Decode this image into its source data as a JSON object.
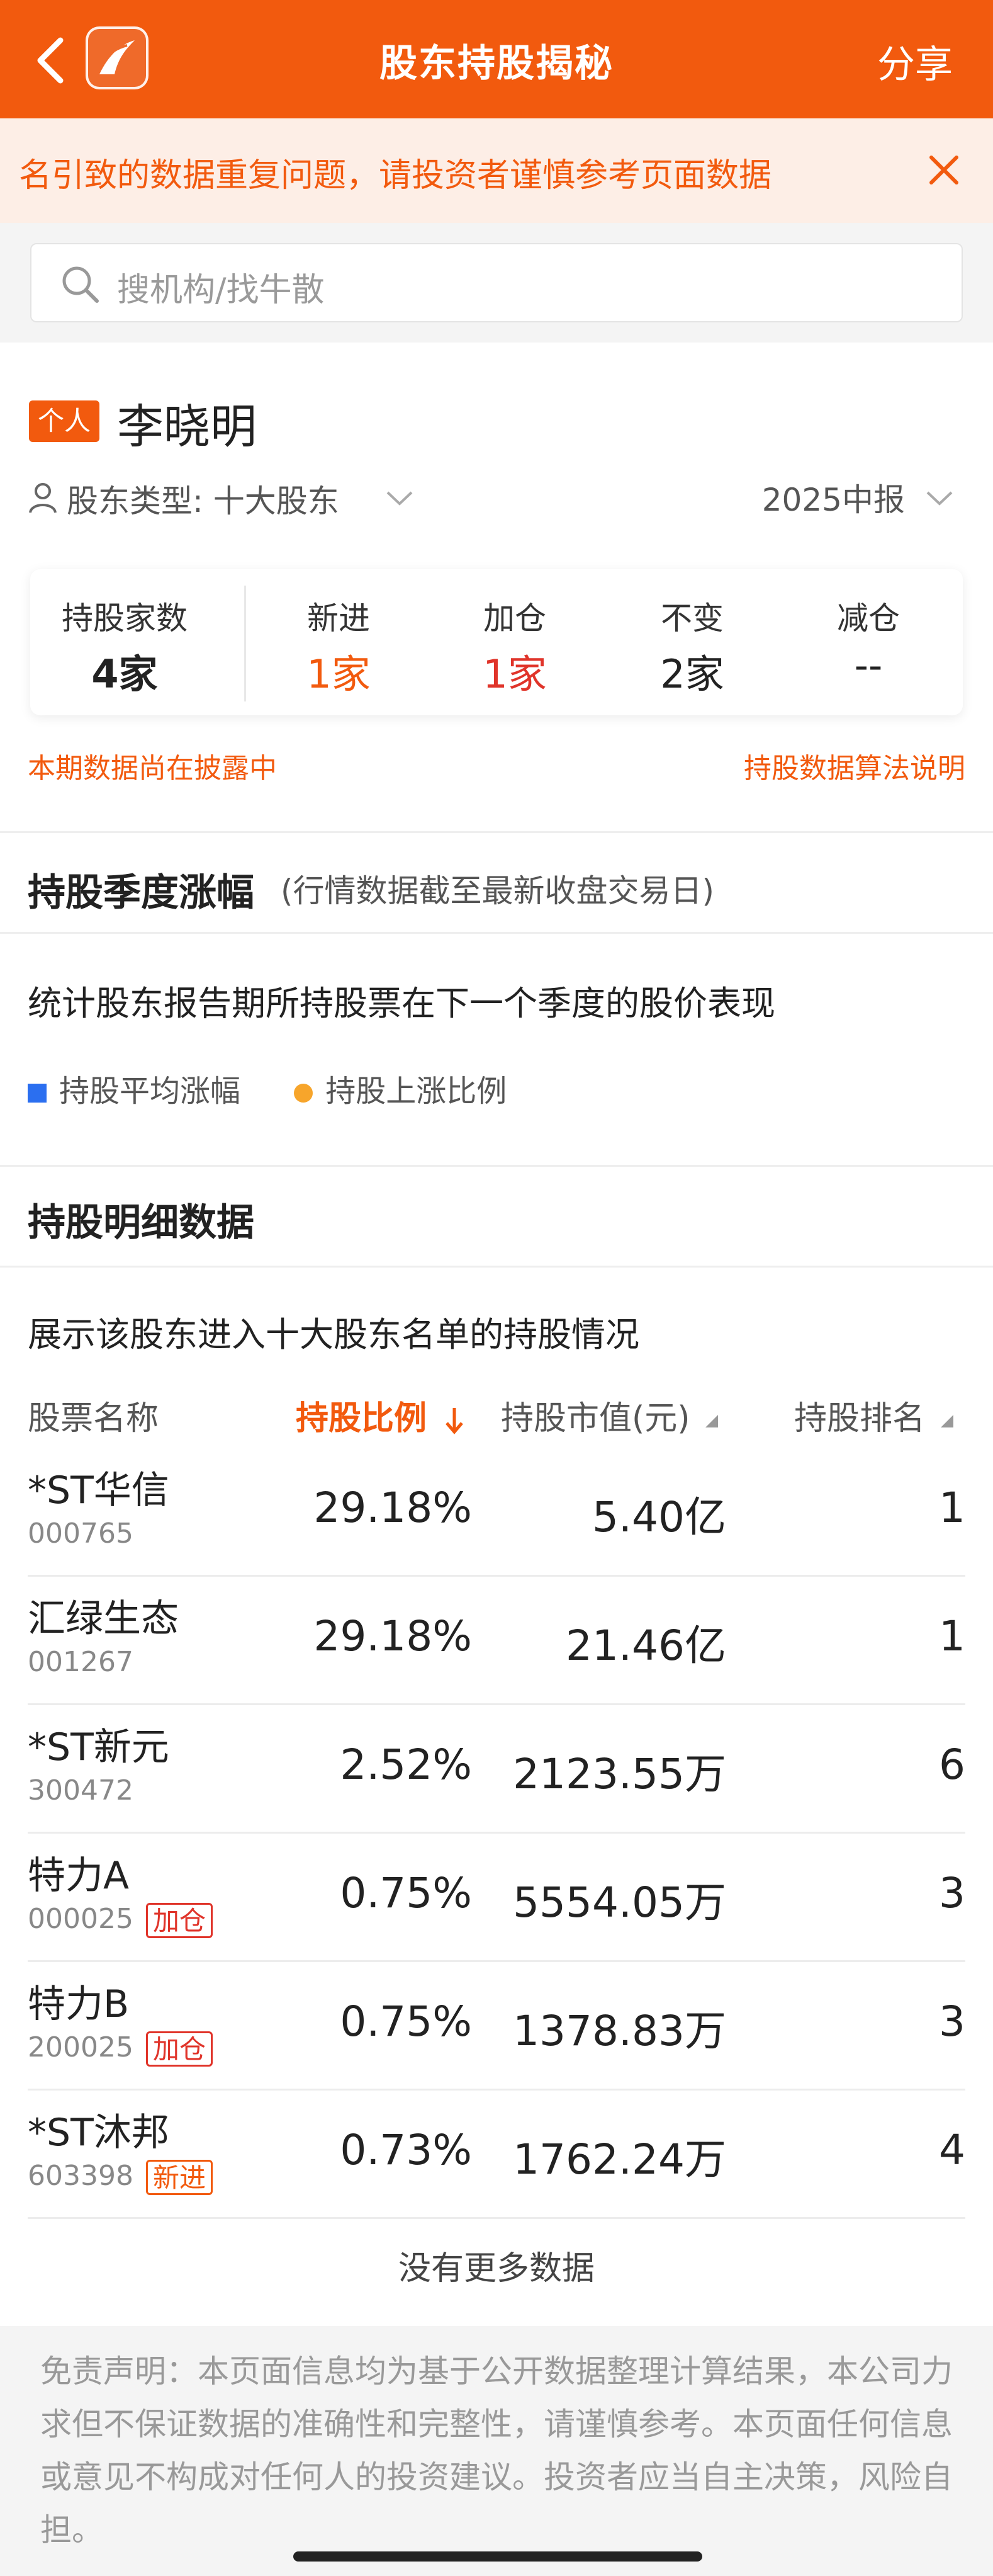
{
  "header": {
    "title": "股东持股揭秘",
    "share_label": "分享",
    "brand_color": "#f25a0e"
  },
  "notice": {
    "text": "名引致的数据重复问题，请投资者谨慎参考页面数据"
  },
  "search": {
    "placeholder": "搜机构/找牛散"
  },
  "profile": {
    "badge": "个人",
    "name": "李晓明",
    "shareholder_type": "股东类型: 十大股东",
    "period": "2025中报",
    "stats": [
      {
        "label": "持股家数",
        "value": "4家",
        "color": "#222222"
      },
      {
        "label": "新进",
        "value": "1家",
        "color": "#f25a0e"
      },
      {
        "label": "加仓",
        "value": "1家",
        "color": "#e0342a"
      },
      {
        "label": "不变",
        "value": "2家",
        "color": "#222222"
      },
      {
        "label": "减仓",
        "value": "--",
        "color": "#222222"
      }
    ],
    "disclosing_text": "本期数据尚在披露中",
    "algorithm_link": "持股数据算法说明"
  },
  "quarterly": {
    "title": "持股季度涨幅",
    "subtitle": "(行情数据截至最新收盘交易日)",
    "description": "统计股东报告期所持股票在下一个季度的股价表现",
    "legend": [
      {
        "label": "持股平均涨幅",
        "color": "#2b6ff0"
      },
      {
        "label": "持股上涨比例",
        "color": "#f7a52b"
      }
    ]
  },
  "detail": {
    "title": "持股明细数据",
    "description": "展示该股东进入十大股东名单的持股情况",
    "columns": {
      "name": "股票名称",
      "ratio": "持股比例",
      "market_value": "持股市值(元)",
      "rank": "持股排名"
    },
    "rows": [
      {
        "name": "*ST华信",
        "code": "000765",
        "tag": "",
        "ratio": "29.18%",
        "market_value": "5.40亿",
        "rank": "1"
      },
      {
        "name": "汇绿生态",
        "code": "001267",
        "tag": "",
        "ratio": "29.18%",
        "market_value": "21.46亿",
        "rank": "1"
      },
      {
        "name": "*ST新元",
        "code": "300472",
        "tag": "",
        "ratio": "2.52%",
        "market_value": "2123.55万",
        "rank": "6"
      },
      {
        "name": "特力A",
        "code": "000025",
        "tag": "加仓",
        "ratio": "0.75%",
        "market_value": "5554.05万",
        "rank": "3"
      },
      {
        "name": "特力B",
        "code": "200025",
        "tag": "加仓",
        "ratio": "0.75%",
        "market_value": "1378.83万",
        "rank": "3"
      },
      {
        "name": "*ST沐邦",
        "code": "603398",
        "tag": "新进",
        "ratio": "0.73%",
        "market_value": "1762.24万",
        "rank": "4"
      }
    ],
    "no_more": "没有更多数据"
  },
  "disclaimer": "免责声明：本页面信息均为基于公开数据整理计算结果，本公司力求但不保证数据的准确性和完整性，请谨慎参考。本页面任何信息或意见不构成对任何人的投资建议。投资者应当自主决策，风险自担。"
}
